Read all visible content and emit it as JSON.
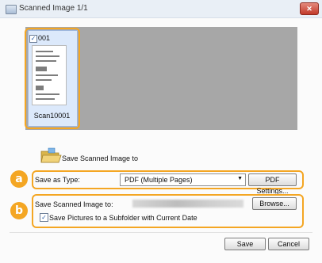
{
  "window": {
    "title": "Scanned Image 1/1",
    "close_glyph": "✕"
  },
  "thumbnail": {
    "checked": true,
    "check_glyph": "✓",
    "page_number": "001",
    "caption": "Scan10001"
  },
  "folder_label": "Save Scanned Image to",
  "save_as": {
    "label": "Save as Type:",
    "selected_value": "PDF (Multiple Pages)",
    "arrow": "▼",
    "settings_button": "PDF Settings..."
  },
  "save_location": {
    "label": "Save Scanned Image to:",
    "browse_button": "Browse...",
    "subfolder_checkbox_label": "Save Pictures to a Subfolder with Current Date",
    "subfolder_checked": true,
    "check_glyph": "✓"
  },
  "badges": {
    "a": "a",
    "b": "b"
  },
  "footer": {
    "save_button": "Save",
    "cancel_button": "Cancel"
  },
  "colors": {
    "highlight": "#f4a623",
    "thumbnail_bg": "#a7a7a7",
    "selected_thumb": "#dce9fb"
  }
}
